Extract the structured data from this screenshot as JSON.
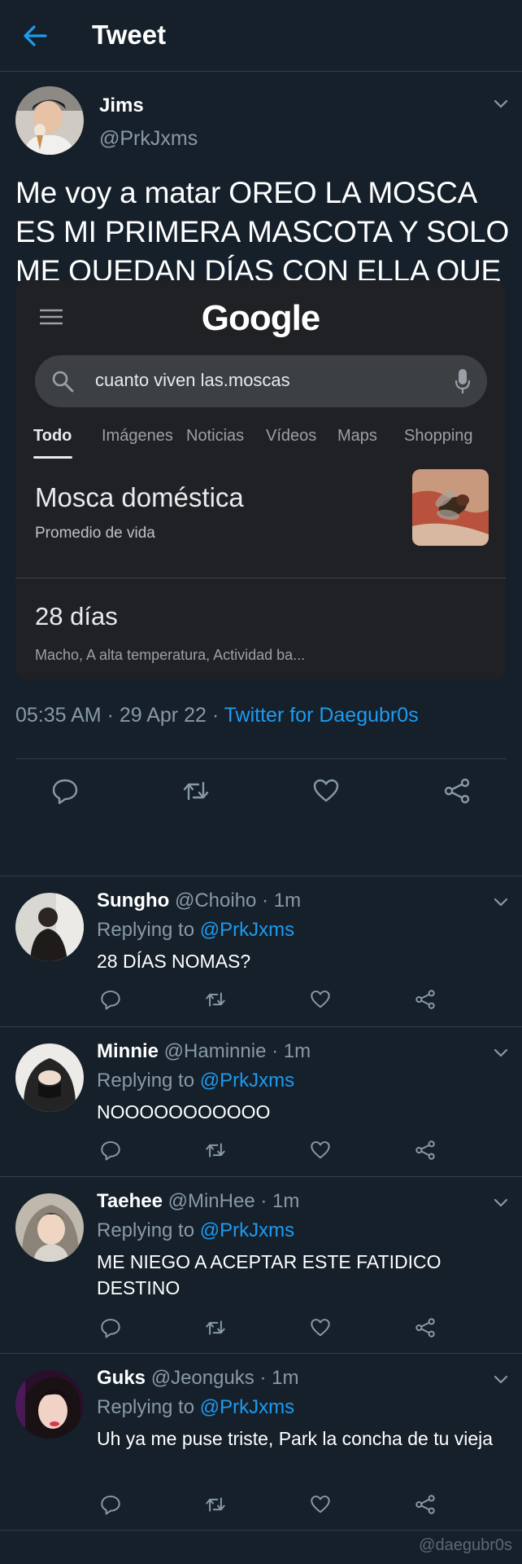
{
  "header": {
    "title": "Tweet"
  },
  "tweet": {
    "name": "Jims",
    "handle": "@PrkJxms",
    "text": "Me voy a matar OREO LA MOSCA ES MI PRIMERA MASCOTA Y SOLO ME QUEDAN DÍAS CON ELLA QUE HAGO ME MATO CON ELLA",
    "time": "05:35 AM",
    "sep1": " · ",
    "date": "29 Apr 22",
    "sep2": " · ",
    "source": "Twitter for Daegubr0s"
  },
  "embed": {
    "logo": "Google",
    "query": "cuanto viven las.moscas",
    "tabs": [
      "Todo",
      "Imágenes",
      "Noticias",
      "Vídeos",
      "Maps",
      "Shopping"
    ],
    "result_title": "Mosca doméstica",
    "result_subtitle": "Promedio de vida",
    "result_value": "28 días",
    "result_detail": "Macho, A alta temperatura, Actividad ba..."
  },
  "replies": [
    {
      "name": "Sungho",
      "handle": "@Choiho",
      "sep": " · ",
      "time": "1m",
      "replying_label": "Replying to ",
      "mention": "@PrkJxms",
      "text": "28 DÍAS NOMAS?"
    },
    {
      "name": "Minnie",
      "handle": "@Haminnie",
      "sep": " · ",
      "time": "1m",
      "replying_label": "Replying to ",
      "mention": "@PrkJxms",
      "text": "NOOOOOOOOOOO"
    },
    {
      "name": "Taehee",
      "handle": "@MinHee",
      "sep": " · ",
      "time": "1m",
      "replying_label": "Replying to ",
      "mention": "@PrkJxms",
      "text": "ME NIEGO A ACEPTAR ESTE FATIDICO DESTINO"
    },
    {
      "name": "Guks",
      "handle": "@Jeonguks",
      "sep": " · ",
      "time": "1m",
      "replying_label": "Replying to ",
      "mention": "@PrkJxms",
      "text": "Uh ya me puse triste, Park la concha de tu vieja"
    }
  ],
  "watermark": "@daegubr0s",
  "colors": {
    "background": "#15202b",
    "accent": "#1d9bf0",
    "secondary_text": "#8899a6",
    "divider": "#2f3d4c"
  },
  "icons": [
    "back-arrow-icon",
    "chevron-down-icon",
    "menu-icon",
    "search-icon",
    "mic-icon",
    "reply-icon",
    "retweet-icon",
    "like-icon",
    "share-icon"
  ]
}
